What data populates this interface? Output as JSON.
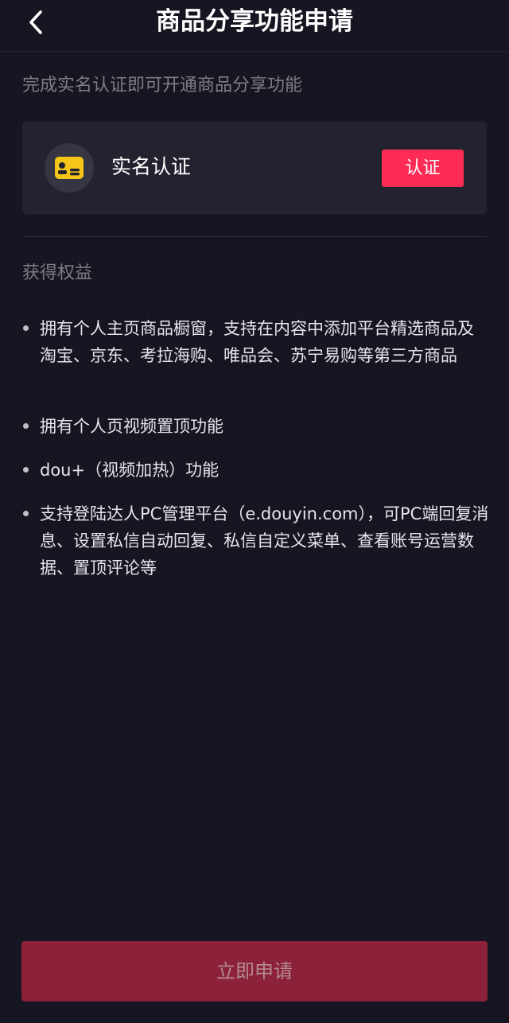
{
  "header": {
    "title": "商品分享功能申请",
    "back_icon": "chevron-left-icon"
  },
  "subtitle": "完成实名认证即可开通商品分享功能",
  "verification_card": {
    "icon": "id-card-icon",
    "label": "实名认证",
    "button_label": "认证"
  },
  "benefits": {
    "title": "获得权益",
    "items": [
      {
        "text": "拥有个人主页商品橱窗，支持在内容中添加平台精选商品及淘宝、京东、考拉海购、唯品会、苏宁易购等第三方商品"
      },
      {
        "text": "拥有个人页视频置顶功能"
      },
      {
        "text": "dou+（视频加热）功能"
      },
      {
        "text": "支持登陆达人PC管理平台（e.douyin.com），可PC端回复消息、设置私信自动回复、私信自定义菜单、查看账号运营数据、置顶评论等"
      }
    ]
  },
  "footer": {
    "submit_label": "立即申请"
  },
  "colors": {
    "background": "#161622",
    "card": "#232330",
    "accent": "#fe2c55",
    "submit_disabled": "#8b2239",
    "id_icon": "#f5c518"
  }
}
